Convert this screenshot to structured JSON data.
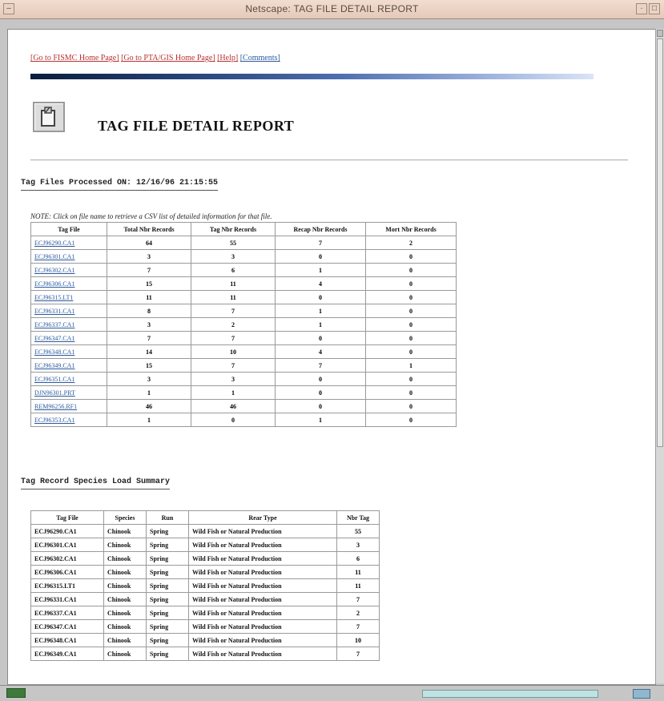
{
  "window": {
    "title": "Netscape: TAG FILE DETAIL REPORT"
  },
  "toplinks": [
    {
      "label": "[Go to FISMC Home Page]"
    },
    {
      "label": "[Go to PTA/GIS Home Page]"
    },
    {
      "label": "[Help]"
    },
    {
      "label": "[Comments]"
    }
  ],
  "page": {
    "heading": "TAG FILE DETAIL REPORT",
    "processed_label": "Tag Files Processed ON: 12/16/96 21:15:55",
    "note": "NOTE: Click on file name to retrieve a CSV list of detailed information for that file.",
    "species_title": "Tag Record Species Load Summary"
  },
  "files_table": {
    "headers": [
      "Tag File",
      "Total Nbr Records",
      "Tag Nbr Records",
      "Recap Nbr Records",
      "Mort Nbr Records"
    ],
    "rows": [
      [
        "ECJ96290.CA1",
        "64",
        "55",
        "7",
        "2"
      ],
      [
        "ECJ96301.CA1",
        "3",
        "3",
        "0",
        "0"
      ],
      [
        "ECJ96302.CA1",
        "7",
        "6",
        "1",
        "0"
      ],
      [
        "ECJ96306.CA1",
        "15",
        "11",
        "4",
        "0"
      ],
      [
        "ECJ96315.LT1",
        "11",
        "11",
        "0",
        "0"
      ],
      [
        "ECJ96331.CA1",
        "8",
        "7",
        "1",
        "0"
      ],
      [
        "ECJ96337.CA1",
        "3",
        "2",
        "1",
        "0"
      ],
      [
        "ECJ96347.CA1",
        "7",
        "7",
        "0",
        "0"
      ],
      [
        "ECJ96348.CA1",
        "14",
        "10",
        "4",
        "0"
      ],
      [
        "ECJ96349.CA1",
        "15",
        "7",
        "7",
        "1"
      ],
      [
        "ECJ96351.CA1",
        "3",
        "3",
        "0",
        "0"
      ],
      [
        "DJN96301.PRT",
        "1",
        "1",
        "0",
        "0"
      ],
      [
        "REM96256.RF1",
        "46",
        "46",
        "0",
        "0"
      ],
      [
        "ECJ96353.CA1",
        "1",
        "0",
        "1",
        "0"
      ]
    ]
  },
  "species_table": {
    "headers": [
      "Tag File",
      "Species",
      "Run",
      "Rear Type",
      "Nbr Tag"
    ],
    "rows": [
      [
        "ECJ96290.CA1",
        "Chinook",
        "Spring",
        "Wild Fish or Natural Production",
        "55"
      ],
      [
        "ECJ96301.CA1",
        "Chinook",
        "Spring",
        "Wild Fish or Natural Production",
        "3"
      ],
      [
        "ECJ96302.CA1",
        "Chinook",
        "Spring",
        "Wild Fish or Natural Production",
        "6"
      ],
      [
        "ECJ96306.CA1",
        "Chinook",
        "Spring",
        "Wild Fish or Natural Production",
        "11"
      ],
      [
        "ECJ96315.LT1",
        "Chinook",
        "Spring",
        "Wild Fish or Natural Production",
        "11"
      ],
      [
        "ECJ96331.CA1",
        "Chinook",
        "Spring",
        "Wild Fish or Natural Production",
        "7"
      ],
      [
        "ECJ96337.CA1",
        "Chinook",
        "Spring",
        "Wild Fish or Natural Production",
        "2"
      ],
      [
        "ECJ96347.CA1",
        "Chinook",
        "Spring",
        "Wild Fish or Natural Production",
        "7"
      ],
      [
        "ECJ96348.CA1",
        "Chinook",
        "Spring",
        "Wild Fish or Natural Production",
        "10"
      ],
      [
        "ECJ96349.CA1",
        "Chinook",
        "Spring",
        "Wild Fish or Natural Production",
        "7"
      ]
    ]
  },
  "colors": {
    "link": "#b83030",
    "visited_link": "#2b5a9e",
    "titlebar": "#e5c9b8"
  },
  "icons": {
    "page_icon": "document-clipboard-icon",
    "status_left": "netscape-status-icon",
    "status_right": "mail-icon"
  }
}
